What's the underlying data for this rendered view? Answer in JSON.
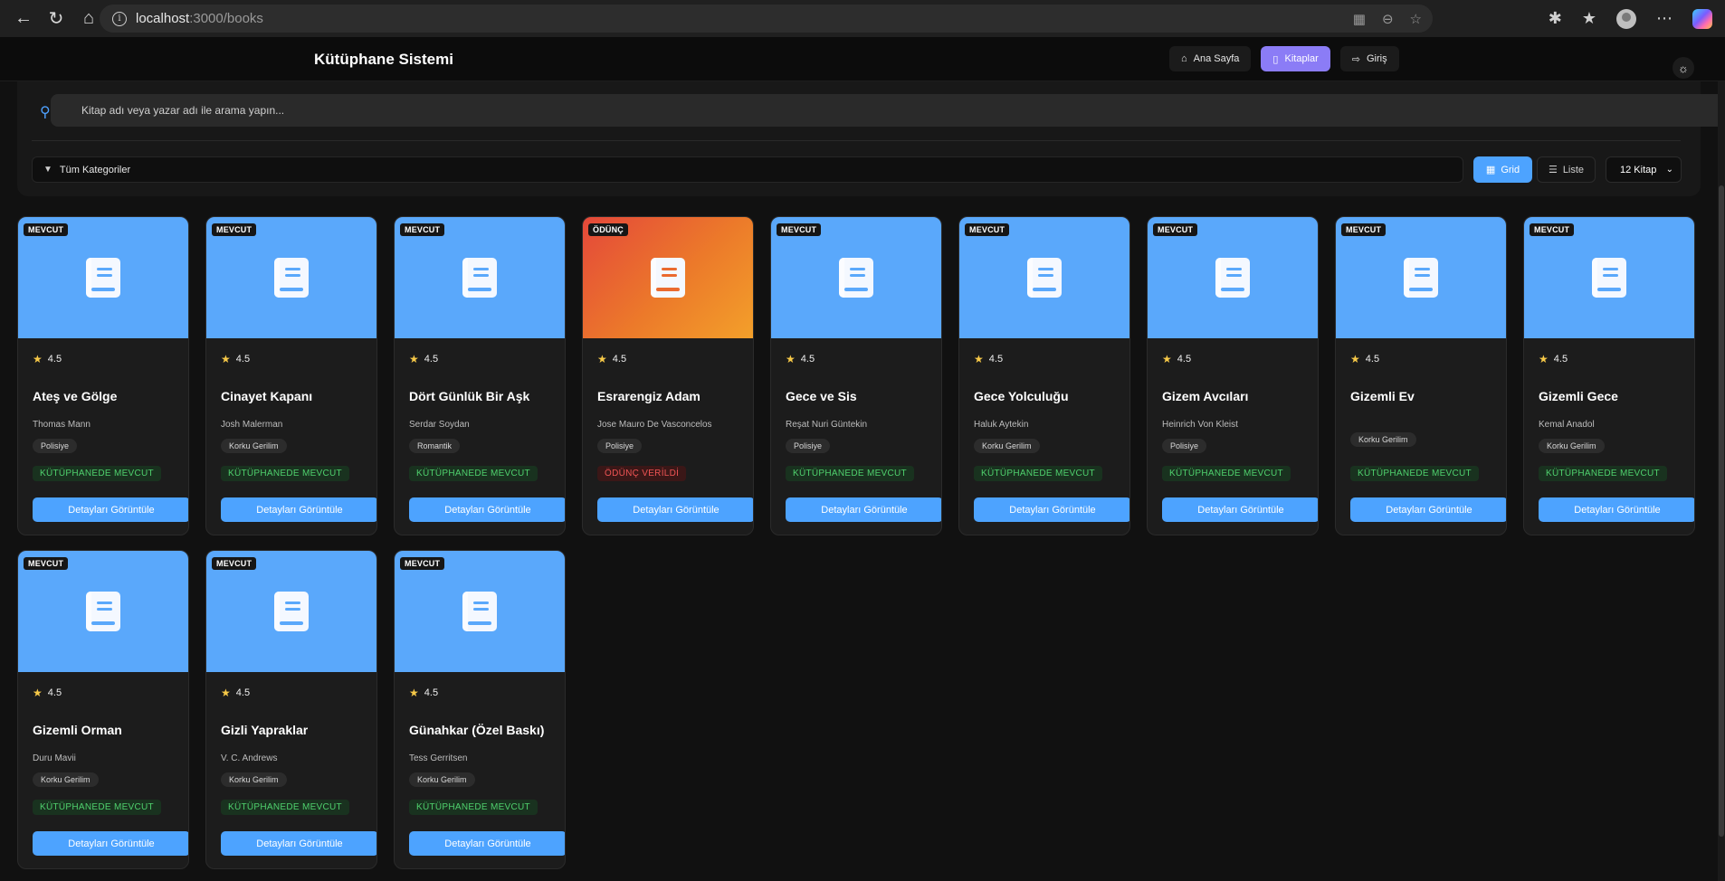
{
  "browser": {
    "url_host": "localhost",
    "url_rest": ":3000/books"
  },
  "header": {
    "brand": "Kütüphane Sistemi",
    "nav": [
      {
        "label": "Ana Sayfa",
        "icon": "home-icon"
      },
      {
        "label": "Kitaplar",
        "icon": "book-icon"
      },
      {
        "label": "Giriş",
        "icon": "login-icon"
      }
    ]
  },
  "filters": {
    "search_placeholder": "Kitap adı veya yazar adı ile arama yapın...",
    "category": "Tüm Kategoriler",
    "grid_label": "Grid",
    "list_label": "Liste",
    "count": "12 Kitap"
  },
  "colors": {
    "accent": "#4da3ff",
    "nav_active": "#8b7cf6",
    "cover": "#5aa8fb",
    "available": "#4fd06d",
    "borrowed": "#ef5454"
  },
  "books": [
    {
      "badge": "MEVCUT",
      "rating": "4.5",
      "title": "Ateş ve Gölge",
      "author": "Thomas Mann",
      "genre": "Polisiye",
      "status": "KÜTÜPHANEDE MEVCUT",
      "borrowed": false,
      "button": "Detayları Görüntüle"
    },
    {
      "badge": "MEVCUT",
      "rating": "4.5",
      "title": "Cinayet Kapanı",
      "author": "Josh Malerman",
      "genre": "Korku Gerilim",
      "status": "KÜTÜPHANEDE MEVCUT",
      "borrowed": false,
      "button": "Detayları Görüntüle"
    },
    {
      "badge": "MEVCUT",
      "rating": "4.5",
      "title": "Dört Günlük Bir Aşk",
      "author": "Serdar Soydan",
      "genre": "Romantik",
      "status": "KÜTÜPHANEDE MEVCUT",
      "borrowed": false,
      "button": "Detayları Görüntüle"
    },
    {
      "badge": "ÖDÜNÇ",
      "rating": "4.5",
      "title": "Esrarengiz Adam",
      "author": "Jose Mauro De Vasconcelos",
      "genre": "Polisiye",
      "status": "ÖDÜNÇ VERİLDİ",
      "borrowed": true,
      "button": "Detayları Görüntüle"
    },
    {
      "badge": "MEVCUT",
      "rating": "4.5",
      "title": "Gece ve Sis",
      "author": "Reşat Nuri Güntekin",
      "genre": "Polisiye",
      "status": "KÜTÜPHANEDE MEVCUT",
      "borrowed": false,
      "button": "Detayları Görüntüle"
    },
    {
      "badge": "MEVCUT",
      "rating": "4.5",
      "title": "Gece Yolculuğu",
      "author": "Haluk Aytekin",
      "genre": "Korku Gerilim",
      "status": "KÜTÜPHANEDE MEVCUT",
      "borrowed": false,
      "button": "Detayları Görüntüle"
    },
    {
      "badge": "MEVCUT",
      "rating": "4.5",
      "title": "Gizem Avcıları",
      "author": "Heinrich Von Kleist",
      "genre": "Polisiye",
      "status": "KÜTÜPHANEDE MEVCUT",
      "borrowed": false,
      "button": "Detayları Görüntüle"
    },
    {
      "badge": "MEVCUT",
      "rating": "4.5",
      "title": "Gizemli Ev",
      "author": "",
      "genre": "Korku Gerilim",
      "status": "KÜTÜPHANEDE MEVCUT",
      "borrowed": false,
      "button": "Detayları Görüntüle"
    },
    {
      "badge": "MEVCUT",
      "rating": "4.5",
      "title": "Gizemli Gece",
      "author": "Kemal Anadol",
      "genre": "Korku Gerilim",
      "status": "KÜTÜPHANEDE MEVCUT",
      "borrowed": false,
      "button": "Detayları Görüntüle"
    },
    {
      "badge": "MEVCUT",
      "rating": "4.5",
      "title": "Gizemli Orman",
      "author": "Duru Mavii",
      "genre": "Korku Gerilim",
      "status": "KÜTÜPHANEDE MEVCUT",
      "borrowed": false,
      "button": "Detayları Görüntüle"
    },
    {
      "badge": "MEVCUT",
      "rating": "4.5",
      "title": "Gizli Yapraklar",
      "author": "V. C. Andrews",
      "genre": "Korku Gerilim",
      "status": "KÜTÜPHANEDE MEVCUT",
      "borrowed": false,
      "button": "Detayları Görüntüle"
    },
    {
      "badge": "MEVCUT",
      "rating": "4.5",
      "title": "Günahkar (Özel Baskı)",
      "author": "Tess Gerritsen",
      "genre": "Korku Gerilim",
      "status": "KÜTÜPHANEDE MEVCUT",
      "borrowed": false,
      "button": "Detayları Görüntüle"
    }
  ]
}
